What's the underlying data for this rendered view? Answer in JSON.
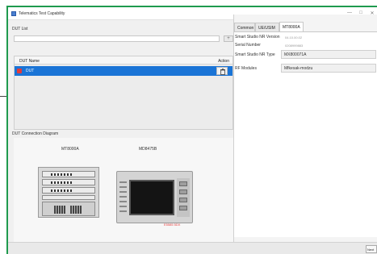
{
  "window": {
    "title": "Telematics Test Capability",
    "controls": [
      "—",
      "□",
      "✕"
    ]
  },
  "dut_list": {
    "label": "DUT List",
    "input_value": "",
    "add_label": "+",
    "columns": [
      "DUT Name",
      "Action"
    ],
    "rows": [
      {
        "name": "DUT"
      }
    ]
  },
  "diagram": {
    "label": "DUT Connection Diagram",
    "device1": "MT8000A",
    "device2": "MD8475B",
    "red_label": "E5585 5DX"
  },
  "right": {
    "tabs": [
      "Common",
      "UE/USIM",
      "MT8000A"
    ],
    "active_tab": "MT8000A",
    "props": {
      "version_label": "Smart Studio NR Version",
      "version_value": "04.10.00.02",
      "serial_label": "Serial Number",
      "serial_value": "0208999883",
      "type_label": "Smart Studio NR Type",
      "type_value": "MX800071A",
      "modules_label": "RF Modules",
      "modules_value": "Mfkesak-modzu"
    }
  },
  "footer": {
    "next_label": "Next"
  },
  "colors": {
    "frame": "#1f9a4e",
    "selection": "#1a74d6"
  }
}
